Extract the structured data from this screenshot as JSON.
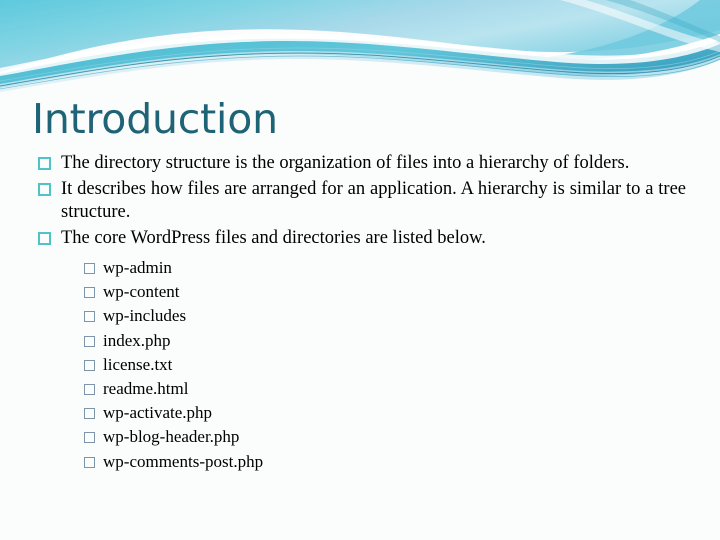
{
  "slide": {
    "title": "Introduction",
    "theme_colors": {
      "title_text": "#1f6377",
      "body_text": "#000000",
      "level1_bullet": "#4ec3c8",
      "level2_bullet": "#7d95a8",
      "wave_light": "#bfe8f2",
      "wave_mid": "#7fd4e3",
      "wave_dark": "#3aa8c4",
      "wave_deep": "#1d7f9e",
      "background": "#fbfcfc"
    },
    "decor": {
      "header_wave_name": "flow-theme-wave",
      "header_wave_label": "Decorative teal wave banner"
    },
    "body": {
      "bullets": [
        {
          "marker": "hollow-square-teal",
          "text": "The directory structure is the organization of files into a hierarchy of folders."
        },
        {
          "marker": "hollow-square-teal",
          "text": "It describes how files are arranged for an application. A hierarchy is similar to a tree structure."
        },
        {
          "marker": "hollow-square-teal",
          "text": "The core WordPress files and directories are listed below."
        }
      ],
      "sub_bullets": [
        {
          "marker": "hollow-square-gray",
          "text": "wp-admin"
        },
        {
          "marker": "hollow-square-gray",
          "text": "wp-content"
        },
        {
          "marker": "hollow-square-gray",
          "text": "wp-includes"
        },
        {
          "marker": "hollow-square-gray",
          "text": "index.php"
        },
        {
          "marker": "hollow-square-gray",
          "text": "license.txt"
        },
        {
          "marker": "hollow-square-gray",
          "text": "readme.html"
        },
        {
          "marker": "hollow-square-gray",
          "text": "wp-activate.php"
        },
        {
          "marker": "hollow-square-gray",
          "text": "wp-blog-header.php"
        },
        {
          "marker": "hollow-square-gray",
          "text": "wp-comments-post.php"
        }
      ]
    }
  }
}
